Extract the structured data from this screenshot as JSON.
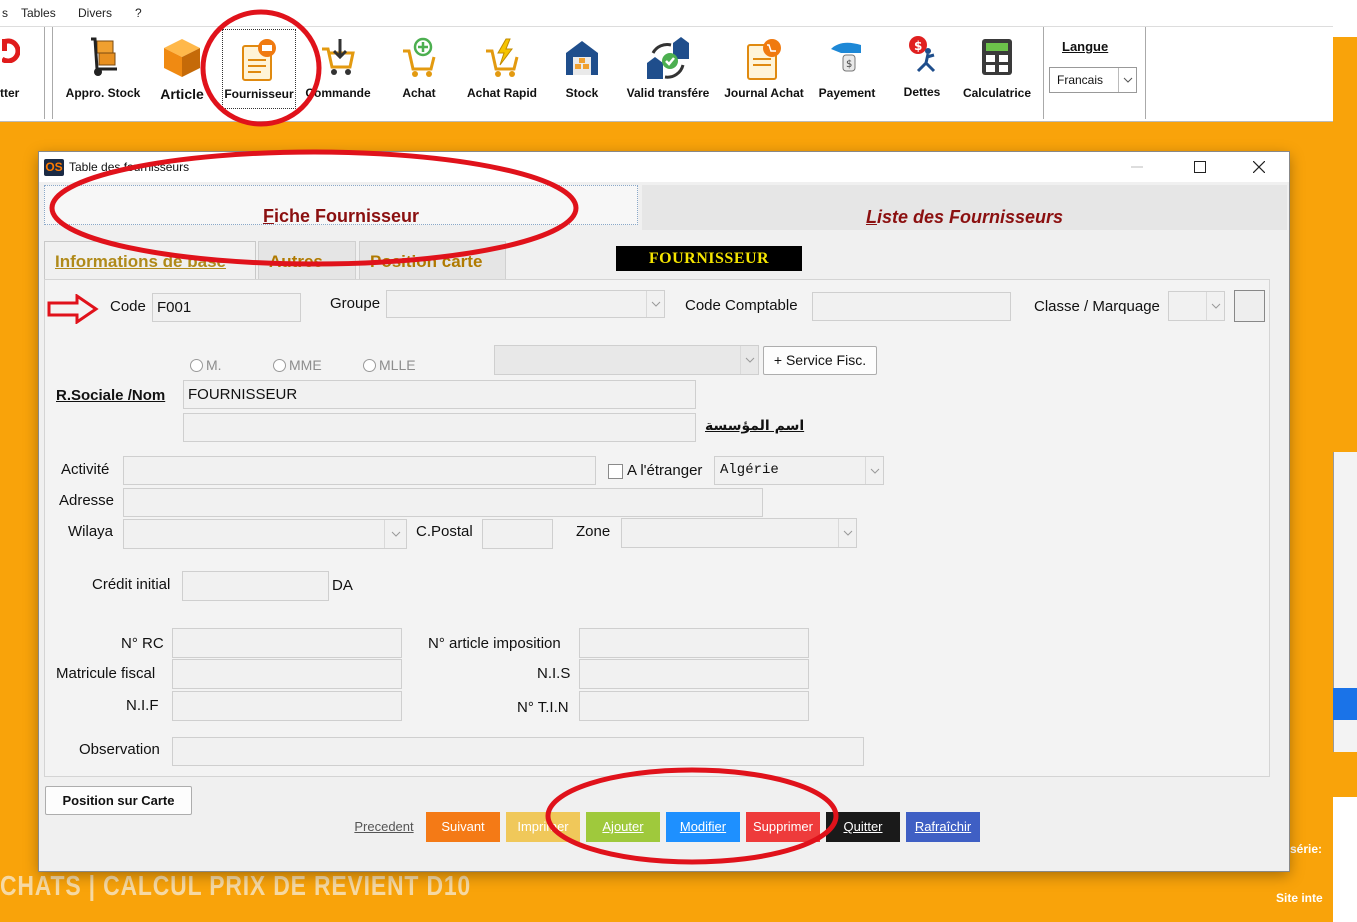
{
  "menu": {
    "item_s": "s",
    "tables": "Tables",
    "divers": "Divers",
    "help": "?"
  },
  "toolbar": {
    "quitter_label": "tter",
    "items": [
      {
        "label": "Appro. Stock"
      },
      {
        "label": "Article"
      },
      {
        "label": "Fournisseur"
      },
      {
        "label": "Commande"
      },
      {
        "label": "Achat"
      },
      {
        "label": "Achat Rapid"
      },
      {
        "label": "Stock"
      },
      {
        "label": "Valid transfére"
      },
      {
        "label": "Journal Achat"
      },
      {
        "label": "Payement"
      },
      {
        "label": "Dettes"
      },
      {
        "label": "Calculatrice"
      }
    ],
    "langue_label": "Langue",
    "langue_value": "Francais"
  },
  "background": {
    "banner_text": "CHATS | CALCUL PRIX DE REVIENT D10",
    "serie_text": "série:",
    "site_text": "Site inte"
  },
  "dialog": {
    "title": "Table des fournisseurs",
    "logo_text": "OS",
    "tabs": {
      "fiche_first": "F",
      "fiche_rest": "iche Fournisseur",
      "liste_first": "L",
      "liste_rest": "iste des Fournisseurs"
    },
    "subtabs": [
      "Informations de base",
      "Autres",
      "Position carte"
    ],
    "badge": "FOURNISSEUR",
    "form": {
      "code_label": "Code",
      "code_value": "F001",
      "groupe_label": "Groupe",
      "code_comptable_label": "Code Comptable",
      "classe_label": "Classe / Marquage",
      "radio_m": "M.",
      "radio_mme": "MME",
      "radio_mlle": "MLLE",
      "service_fisc_button": "+ Service Fisc.",
      "rsociale_label": "R.Sociale /Nom",
      "rsociale_value": "FOURNISSEUR",
      "arabic_label": "اسم المؤسسة",
      "activite_label": "Activité",
      "etranger_label": "A l'étranger",
      "pays_value": "Algérie",
      "adresse_label": "Adresse",
      "wilaya_label": "Wilaya",
      "cpostal_label": "C.Postal",
      "zone_label": "Zone",
      "credit_label": "Crédit initial",
      "credit_unit": "DA",
      "nrc_label": "N° RC",
      "article_imposition_label": "N° article imposition",
      "matricule_label": "Matricule fiscal",
      "nis_label": "N.I.S",
      "nif_label": "N.I.F",
      "tin_label": "N° T.I.N",
      "observation_label": "Observation"
    },
    "position_carte_button": "Position sur Carte",
    "actions": {
      "precedent": "Precedent",
      "suivant": "Suivant",
      "imprimer": "Imprimer",
      "ajouter": "Ajouter",
      "modifier": "Modifier",
      "supprimer": "Supprimer",
      "quitter": "Quitter",
      "rafraichir": "Rafraîchir"
    }
  },
  "colors": {
    "background_orange": "#f9a30a",
    "tab_title_red": "#8b1010",
    "badge_bg": "#000000",
    "badge_text": "#f5e500",
    "suivant": "#f47a16",
    "imprimer": "#f0c85a",
    "ajouter": "#9fc93c",
    "modifier": "#1e90ff",
    "supprimer": "#ee3b3b",
    "quitter": "#1a1a1a",
    "rafraichir": "#3f5fc4",
    "annotation_red": "#e0121b"
  }
}
